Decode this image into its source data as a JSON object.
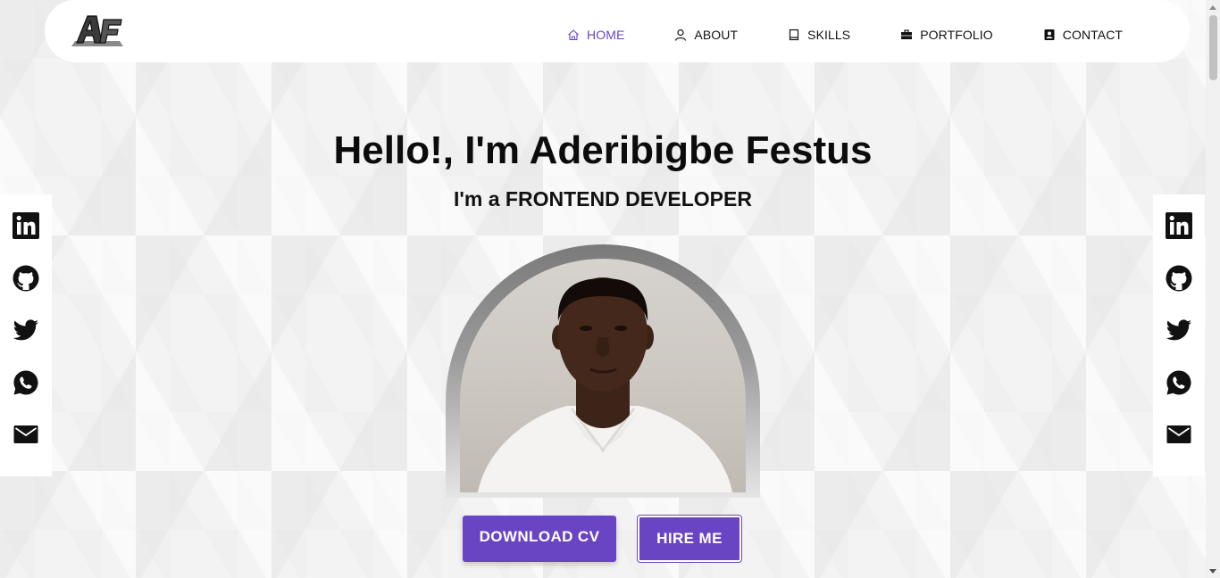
{
  "logo": {
    "alt_text": "AF"
  },
  "nav": {
    "items": [
      {
        "label": "HOME",
        "icon": "home-icon",
        "active": true
      },
      {
        "label": "ABOUT",
        "icon": "user-icon",
        "active": false
      },
      {
        "label": "SKILLS",
        "icon": "book-icon",
        "active": false
      },
      {
        "label": "PORTFOLIO",
        "icon": "briefcase-icon",
        "active": false
      },
      {
        "label": "CONTACT",
        "icon": "contact-card-icon",
        "active": false
      }
    ]
  },
  "hero": {
    "title": "Hello!, I'm Aderibigbe Festus",
    "subtitle": "I'm a FRONTEND DEVELOPER",
    "download_label": "DOWNLOAD CV",
    "hire_label": "HIRE ME"
  },
  "social": [
    "linkedin-icon",
    "github-icon",
    "twitter-icon",
    "whatsapp-icon",
    "mail-icon"
  ],
  "colors": {
    "accent": "#6a45c3",
    "text": "#111111",
    "background": "#f3f3f3"
  }
}
